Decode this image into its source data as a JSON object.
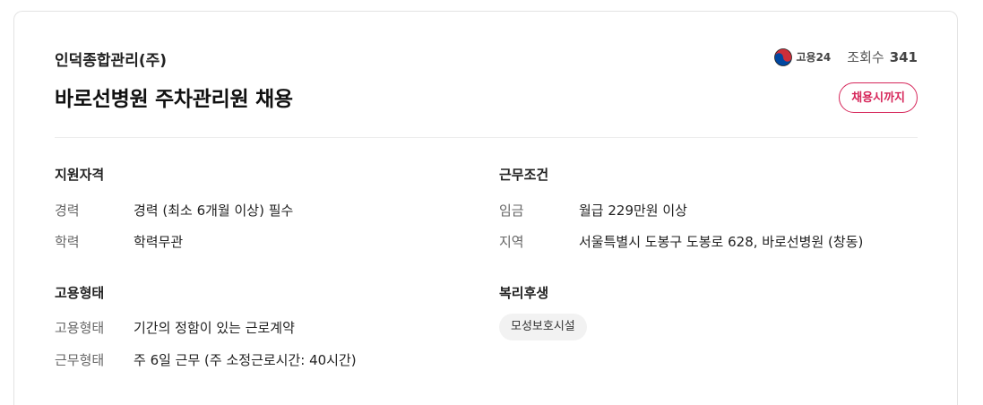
{
  "header": {
    "company": "인덕종합관리(주)",
    "title": "바로선병원 주차관리원 채용",
    "source_logo_text": "고용24",
    "views_label": "조회수",
    "views_count": "341",
    "deadline_button": "채용시까지"
  },
  "qualifications": {
    "title": "지원자격",
    "rows": [
      {
        "label": "경력",
        "value": "경력 (최소 6개월 이상) 필수"
      },
      {
        "label": "학력",
        "value": "학력무관"
      }
    ]
  },
  "conditions": {
    "title": "근무조건",
    "rows": [
      {
        "label": "임금",
        "value": "월급 229만원 이상"
      },
      {
        "label": "지역",
        "value": "서울특별시 도봉구 도봉로 628, 바로선병원 (창동)"
      }
    ]
  },
  "employment": {
    "title": "고용형태",
    "rows": [
      {
        "label": "고용형태",
        "value": "기간의 정함이 있는 근로계약"
      },
      {
        "label": "근무형태",
        "value": "주 6일 근무 (주 소정근로시간: 40시간)"
      }
    ]
  },
  "welfare": {
    "title": "복리후생",
    "chips": [
      "모성보호시설"
    ]
  },
  "colors": {
    "accent": "#d6265a",
    "taegeuk_red": "#cd2e3a",
    "taegeuk_blue": "#0047a0"
  },
  "icons": {
    "source_logo": "taegeuk-icon"
  }
}
